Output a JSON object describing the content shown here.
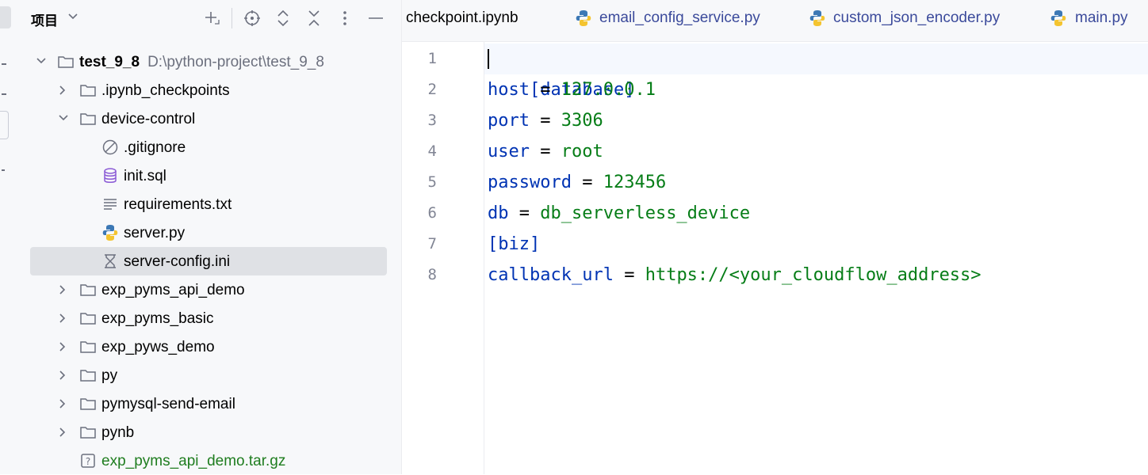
{
  "project_panel": {
    "title": "项目",
    "tree": [
      {
        "name": "test_9_8",
        "path": "D:\\python-project\\test_9_8",
        "icon": "folder-icon",
        "expanded": true
      },
      {
        "name": ".ipynb_checkpoints",
        "icon": "folder-icon",
        "expanded": false
      },
      {
        "name": "device-control",
        "icon": "folder-icon",
        "expanded": true
      },
      {
        "name": ".gitignore",
        "icon": "ignore-file-icon"
      },
      {
        "name": "init.sql",
        "icon": "database-icon"
      },
      {
        "name": "requirements.txt",
        "icon": "text-file-icon"
      },
      {
        "name": "server.py",
        "icon": "python-icon"
      },
      {
        "name": "server-config.ini",
        "icon": "config-file-icon",
        "selected": true
      },
      {
        "name": "exp_pyms_api_demo",
        "icon": "folder-icon",
        "expanded": false
      },
      {
        "name": "exp_pyms_basic",
        "icon": "folder-icon",
        "expanded": false
      },
      {
        "name": "exp_pyws_demo",
        "icon": "folder-icon",
        "expanded": false
      },
      {
        "name": "py",
        "icon": "folder-icon",
        "expanded": false
      },
      {
        "name": "pymysql-send-email",
        "icon": "folder-icon",
        "expanded": false
      },
      {
        "name": "pynb",
        "icon": "folder-icon",
        "expanded": false
      },
      {
        "name": "exp_pyms_api_demo.tar.gz",
        "icon": "unknown-file-icon"
      }
    ]
  },
  "tabs": [
    {
      "label": "checkpoint.ipynb"
    },
    {
      "label": "email_config_service.py",
      "icon": "python-icon"
    },
    {
      "label": "custom_json_encoder.py",
      "icon": "python-icon"
    },
    {
      "label": "main.py",
      "icon": "python-icon"
    }
  ],
  "editor": {
    "lines": [
      {
        "num": "1",
        "text": "[database]"
      },
      {
        "num": "2",
        "key": "host",
        "eq": " = ",
        "value": "127.0.0.1"
      },
      {
        "num": "3",
        "key": "port",
        "eq": " = ",
        "value": "3306"
      },
      {
        "num": "4",
        "key": "user",
        "eq": " = ",
        "value": "root"
      },
      {
        "num": "5",
        "key": "password",
        "eq": " = ",
        "value": "123456"
      },
      {
        "num": "6",
        "key": "db",
        "eq": " = ",
        "value": "db_serverless_device"
      },
      {
        "num": "7",
        "text": "[biz]"
      },
      {
        "num": "8",
        "key": "callback_url",
        "eq": " = ",
        "value": "https://<your_cloudflow_address>"
      }
    ]
  },
  "colors": {
    "key": "#0033b3",
    "value": "#067d17",
    "tab_text": "#3b4a9b",
    "selection": "#dfe1e5"
  }
}
